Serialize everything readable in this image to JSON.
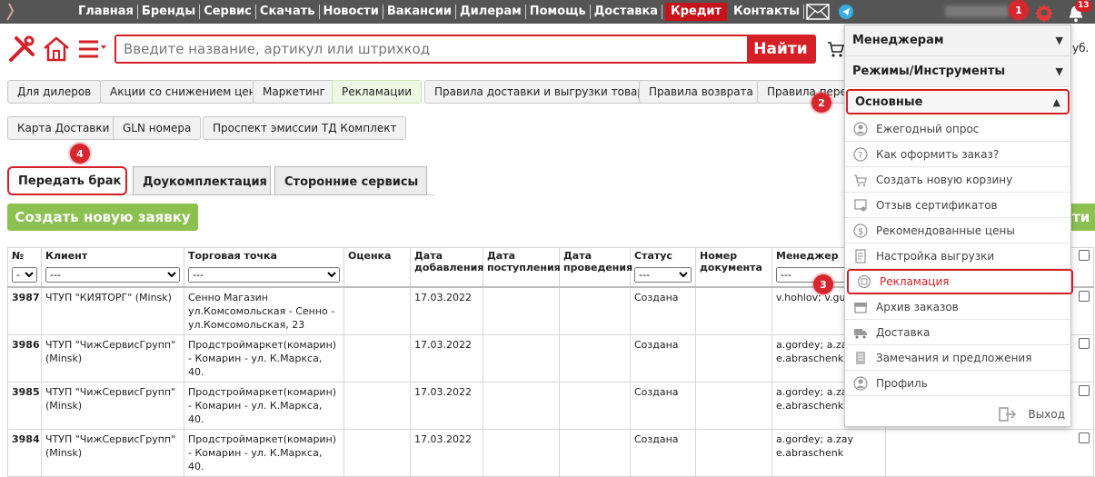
{
  "nav": {
    "items": [
      "Главная",
      "Бренды",
      "Сервис",
      "Скачать",
      "Новости",
      "Вакансии",
      "Дилерам",
      "Помощь",
      "Доставка"
    ],
    "credit": "Кредит",
    "contacts": "Контакты",
    "notifications_count": "13",
    "colors": {
      "bar": "#555555",
      "credit": "#c7131a",
      "accent": "#d41f26",
      "green": "#8cc051"
    }
  },
  "callouts": [
    "1",
    "2",
    "3",
    "4"
  ],
  "search": {
    "placeholder": "Введите название, артикул или штрихкод",
    "button": "Найти"
  },
  "header": {
    "rub_suffix": "уб."
  },
  "chips": [
    "Для дилеров",
    "Акции со снижением цен",
    "Маркетинг",
    "Рекламации",
    "Правила доставки и выгрузки товара",
    "Правила возврата",
    "Правила перед",
    "Карта Доставки",
    "GLN номера",
    "Проспект эмиссии ТД Комплект"
  ],
  "tabs": [
    "Передать брак",
    "Доукомплектация",
    "Сторонние сервисы"
  ],
  "create_button": "Создать новую заявку",
  "green_right_text": "ти",
  "table": {
    "headers": [
      "№",
      "Клиент",
      "Торговая точка",
      "Оценка",
      "Дата добавления",
      "Дата поступления",
      "Дата проведения",
      "Статус",
      "Номер документа",
      "Менеджер"
    ],
    "filter_values": [
      "-",
      "---",
      "---",
      "---",
      "---"
    ],
    "rows": [
      {
        "num": "3987",
        "client": "ЧТУП \"КИЯТОРГ\" (Minsk)",
        "point": "Сенно Магазин ул.Комсомольская - Сенно - ул.Комсомольская, 23",
        "date": "17.03.2022",
        "status": "Создана",
        "manager": "v.hohlov; v.gug"
      },
      {
        "num": "3986",
        "client": "ЧТУП \"ЧижСервисГрупп\" (Minsk)",
        "point": "Продстроймаркет(комарин) - Комарин - ул. К.Маркса, 40.",
        "date": "17.03.2022",
        "status": "Создана",
        "manager": "a.gordey; a.zay e.abraschenk"
      },
      {
        "num": "3985",
        "client": "ЧТУП \"ЧижСервисГрупп\" (Minsk)",
        "point": "Продстроймаркет(комарин) - Комарин - ул. К.Маркса, 40.",
        "date": "17.03.2022",
        "status": "Создана",
        "manager": "a.gordey; a.zay e.abraschenk"
      },
      {
        "num": "3984",
        "client": "ЧТУП \"ЧижСервисГрупп\" (Minsk)",
        "point": "Продстроймаркет(комарин) - Комарин - ул. К.Маркса, 40.",
        "date": "17.03.2022",
        "status": "Создана",
        "manager": "a.gordey; a.zay e.abraschenk"
      }
    ]
  },
  "menu": {
    "sections": [
      "Менеджерам",
      "Режимы/Инструменты",
      "Основные"
    ],
    "items": [
      {
        "label": "Ежегодный опрос",
        "icon": "user-circle-icon"
      },
      {
        "label": "Как оформить заказ?",
        "icon": "question-icon"
      },
      {
        "label": "Создать новую корзину",
        "icon": "cart-plus-icon"
      },
      {
        "label": "Отзыв сертификатов",
        "icon": "certificate-icon"
      },
      {
        "label": "Рекомендованные цены",
        "icon": "coin-icon"
      },
      {
        "label": "Настройка выгрузки",
        "icon": "document-icon"
      },
      {
        "label": "Рекламация",
        "icon": "claim-icon"
      },
      {
        "label": "Архив заказов",
        "icon": "archive-icon"
      },
      {
        "label": "Доставка",
        "icon": "truck-icon"
      },
      {
        "label": "Замечания и предложения",
        "icon": "notes-icon"
      },
      {
        "label": "Профиль",
        "icon": "profile-icon"
      }
    ],
    "exit": "Выход"
  }
}
